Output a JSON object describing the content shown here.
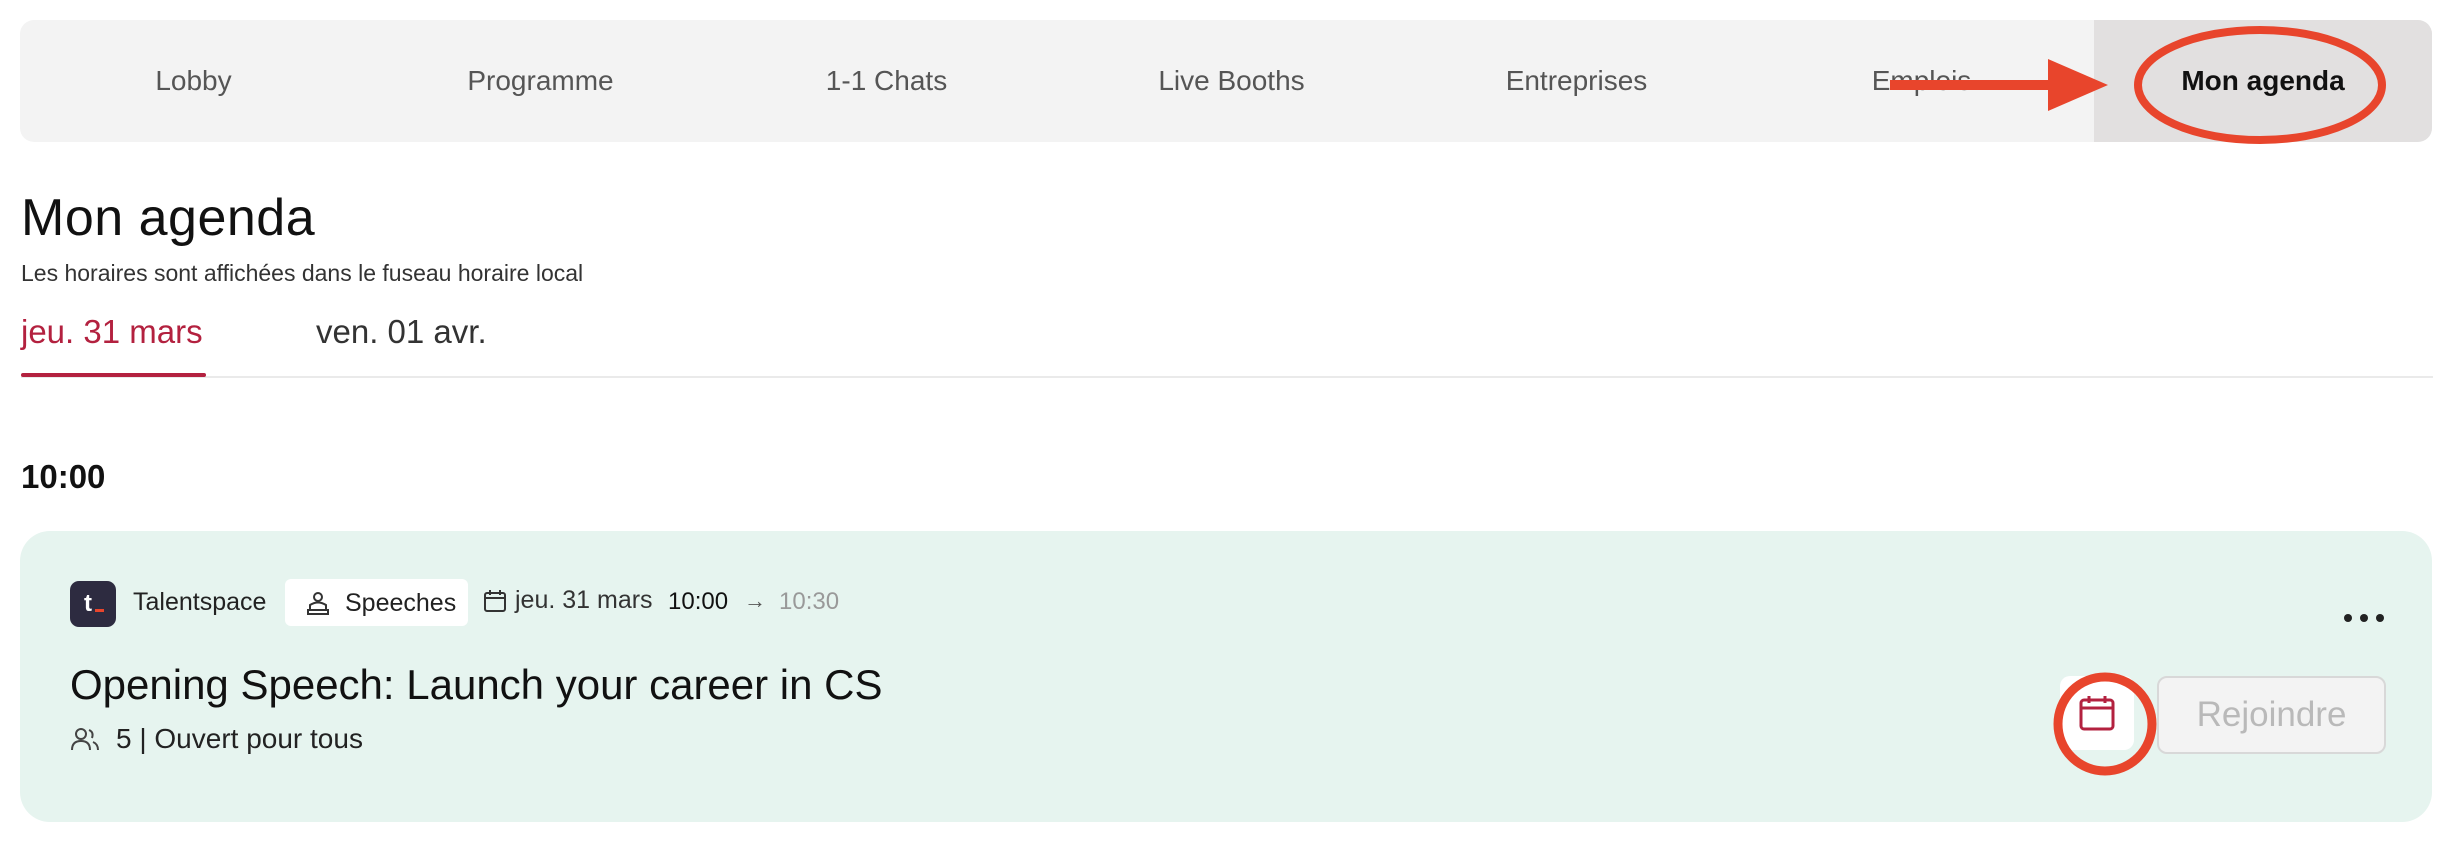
{
  "nav": {
    "items": [
      {
        "label": "Lobby"
      },
      {
        "label": "Programme"
      },
      {
        "label": "1-1 Chats"
      },
      {
        "label": "Live Booths"
      },
      {
        "label": "Entreprises"
      },
      {
        "label": "Emplois"
      },
      {
        "label": "Mon agenda",
        "active": true
      }
    ]
  },
  "page": {
    "title": "Mon agenda",
    "subtitle": "Les horaires sont affichées dans le fuseau horaire local"
  },
  "day_tabs": [
    {
      "label": "jeu. 31 mars",
      "active": true
    },
    {
      "label": "ven. 01 avr."
    }
  ],
  "time_slot": "10:00",
  "session": {
    "organizer": "Talentspace",
    "type": "Speeches",
    "date": "jeu. 31 mars",
    "start": "10:00",
    "arrow": "→",
    "end": "10:30",
    "title": "Opening Speech: Launch your career in CS",
    "attendees": "5 | Ouvert pour tous",
    "join_label": "Rejoindre"
  },
  "colors": {
    "accent": "#b3213f",
    "annotation": "#e8452c",
    "card_bg": "#e6f4ef",
    "nav_bg": "#f3f3f3"
  },
  "icons": {
    "org_logo": "talentspace-logo",
    "type": "presenter-icon",
    "date": "calendar-icon",
    "attendees": "users-icon",
    "more": "more-horizontal-icon",
    "add_to_calendar": "calendar-icon"
  }
}
